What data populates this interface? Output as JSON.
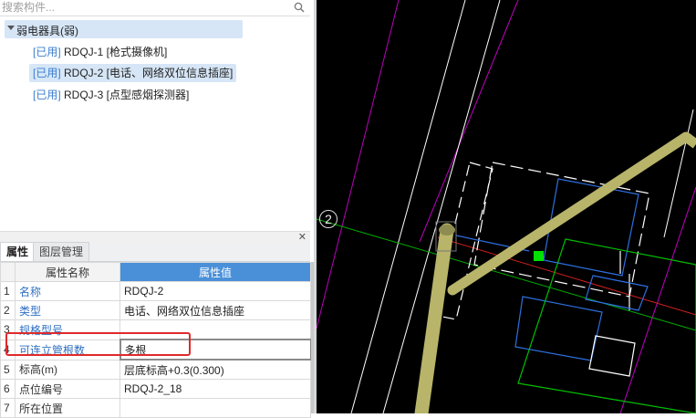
{
  "search": {
    "placeholder": "搜索构件..."
  },
  "tree": {
    "root": "弱电器具(弱)",
    "items": [
      {
        "tag": "[已用]",
        "text": "RDQJ-1 [枪式摄像机]"
      },
      {
        "tag": "[已用]",
        "text": "RDQJ-2 [电话、网络双位信息插座]"
      },
      {
        "tag": "[已用]",
        "text": "RDQJ-3 [点型感烟探测器]"
      }
    ]
  },
  "tabs": {
    "properties": "属性",
    "layer_manage": "图层管理"
  },
  "table": {
    "col_name": "属性名称",
    "col_value": "属性值",
    "rows": [
      {
        "num": "1",
        "name": "名称",
        "value": "RDQJ-2"
      },
      {
        "num": "2",
        "name": "类型",
        "value": "电话、网络双位信息插座"
      },
      {
        "num": "3",
        "name": "规格型号",
        "value": ""
      },
      {
        "num": "4",
        "name": "可连立管根数",
        "value": "多根"
      },
      {
        "num": "5",
        "name": "标高(m)",
        "value": "层底标高+0.3(0.300)"
      },
      {
        "num": "6",
        "name": "点位编号",
        "value": "RDQJ-2_18"
      },
      {
        "num": "7",
        "name": "所在位置",
        "value": ""
      }
    ]
  },
  "canvas": {
    "axis_label": "2"
  },
  "colors": {
    "accent": "#4a90d9",
    "highlight_red": "#e02a2a",
    "selection": "#d6e6f7",
    "canvas_bg": "#000000"
  }
}
